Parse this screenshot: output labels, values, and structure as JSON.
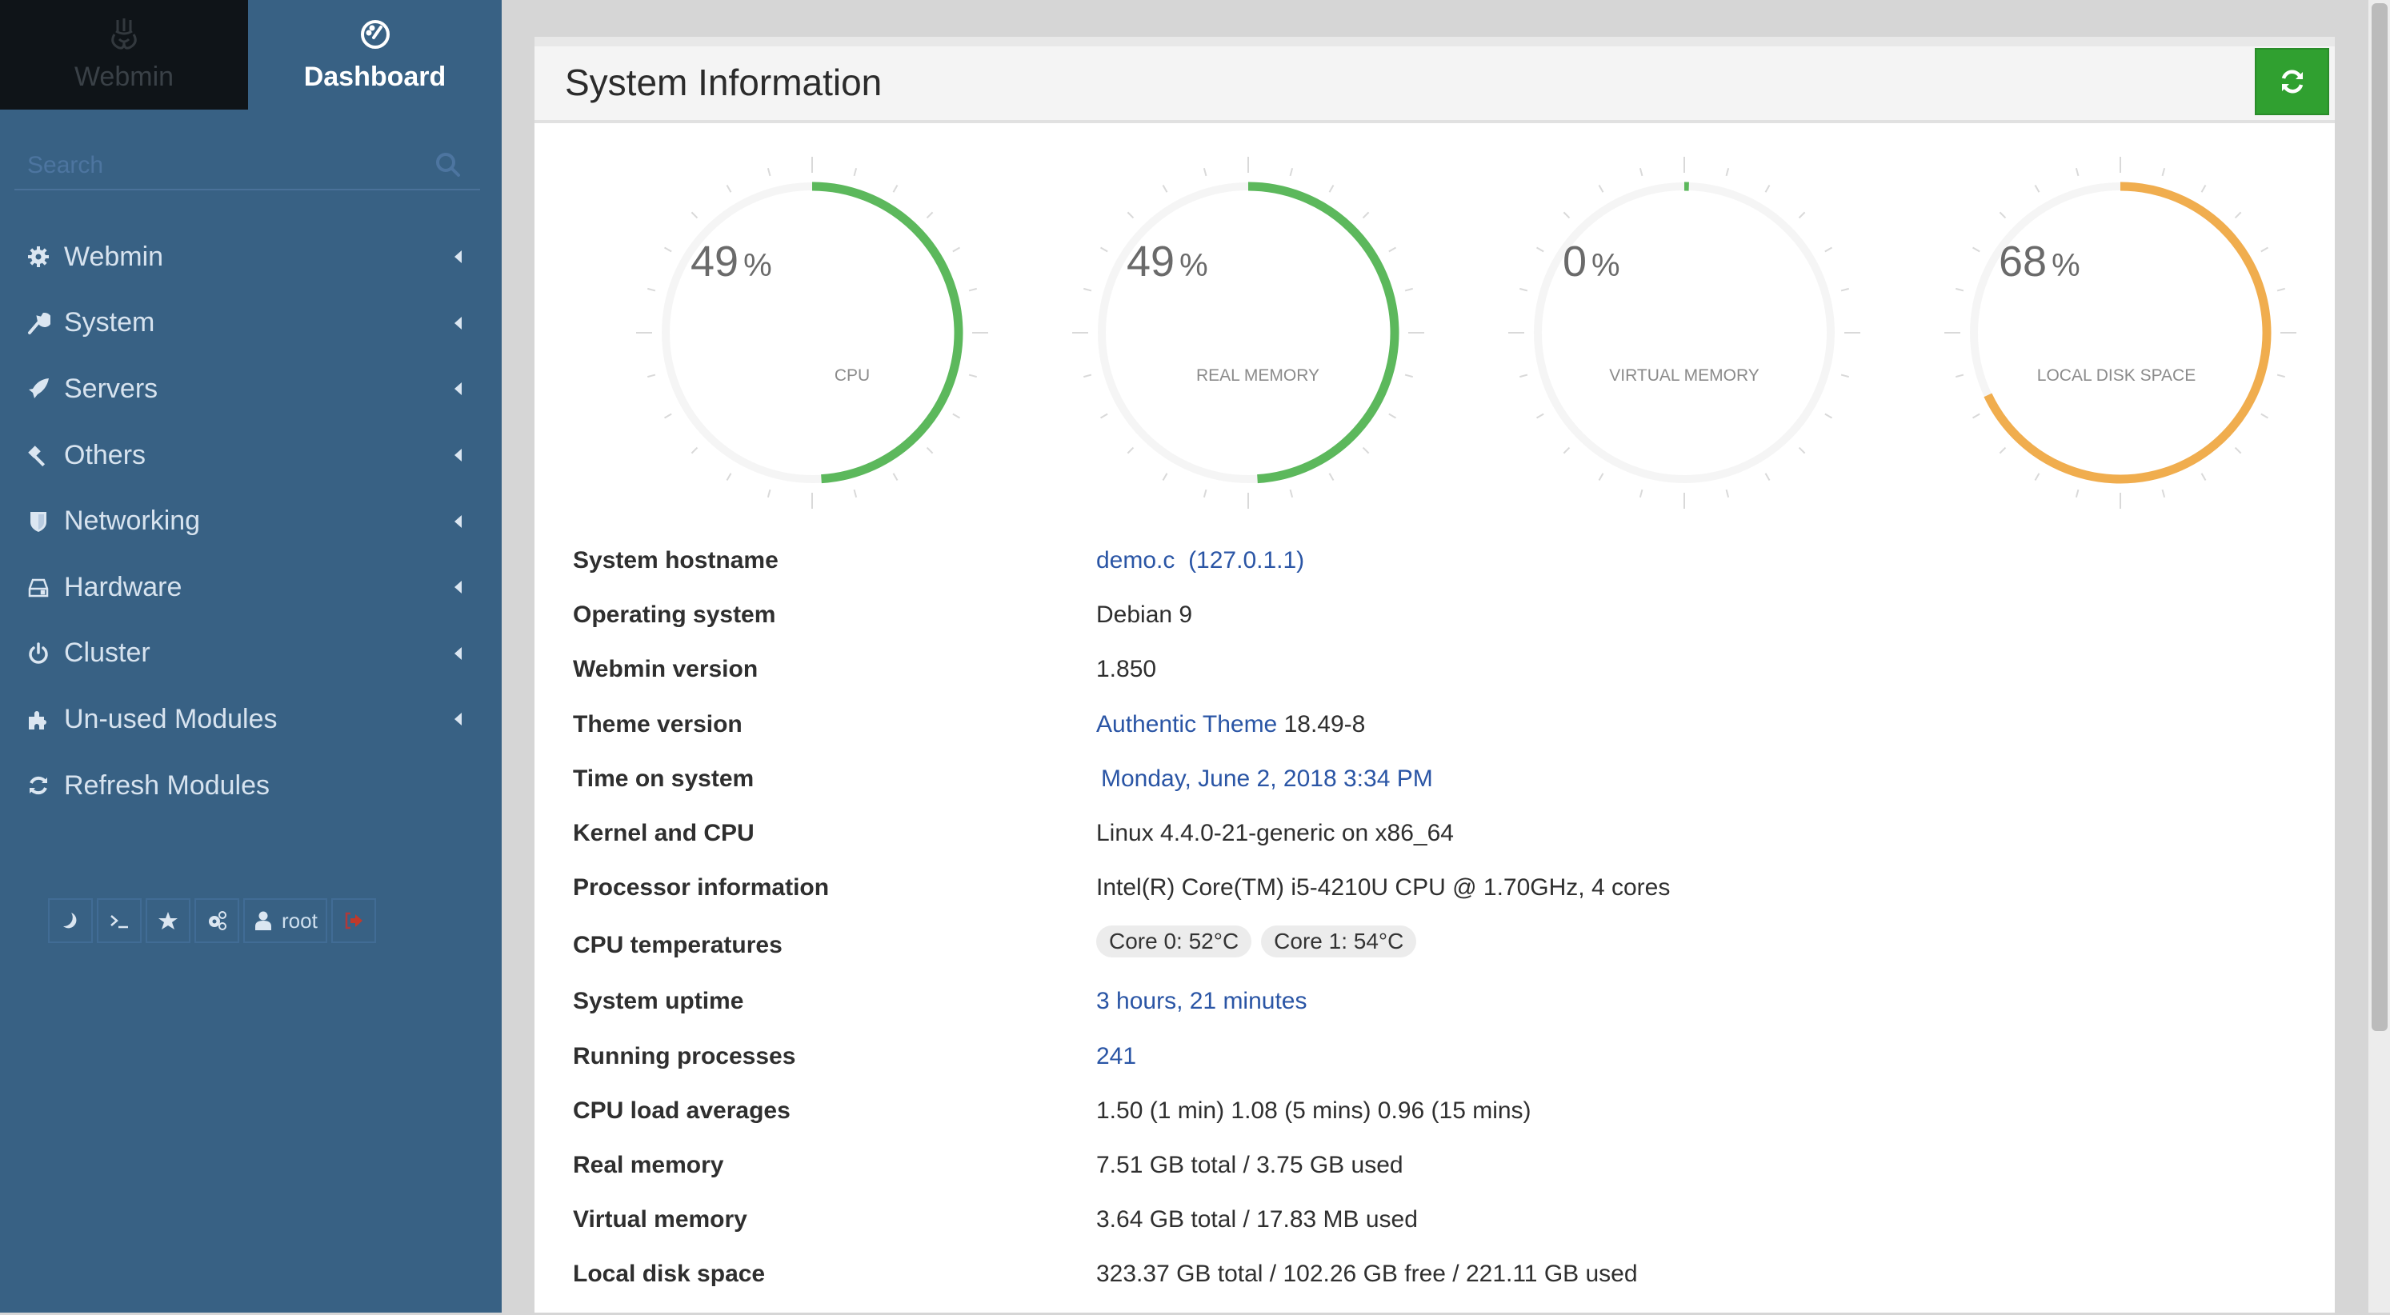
{
  "sidebar": {
    "tabs": [
      {
        "label": "Webmin",
        "icon": "webmin-logo-icon",
        "active": false
      },
      {
        "label": "Dashboard",
        "icon": "dashboard-gauge-icon",
        "active": true
      }
    ],
    "search": {
      "placeholder": "Search",
      "value": ""
    },
    "nav_items": [
      {
        "label": "Webmin",
        "icon": "gear-icon",
        "has_submenu": true
      },
      {
        "label": "System",
        "icon": "wrench-icon",
        "has_submenu": true
      },
      {
        "label": "Servers",
        "icon": "rocket-icon",
        "has_submenu": true
      },
      {
        "label": "Others",
        "icon": "gavel-icon",
        "has_submenu": true
      },
      {
        "label": "Networking",
        "icon": "shield-icon",
        "has_submenu": true
      },
      {
        "label": "Hardware",
        "icon": "hdd-icon",
        "has_submenu": true
      },
      {
        "label": "Cluster",
        "icon": "power-icon",
        "has_submenu": true
      },
      {
        "label": "Un-used Modules",
        "icon": "puzzle-icon",
        "has_submenu": true
      },
      {
        "label": "Refresh Modules",
        "icon": "refresh-icon",
        "has_submenu": false
      }
    ],
    "toolbar": {
      "night_mode_icon": "moon-icon",
      "terminal_icon": "terminal-icon",
      "favorites_icon": "star-icon",
      "settings_icon": "cogs-icon",
      "user_icon": "user-icon",
      "user_label": "root",
      "logout_icon": "sign-out-icon"
    }
  },
  "panel": {
    "title": "System Information",
    "refresh_icon": "refresh-icon",
    "refresh_color": "#30a030"
  },
  "gauges": [
    {
      "value": 49,
      "unit": "%",
      "label": "CPU",
      "color": "#5cb85c"
    },
    {
      "value": 49,
      "unit": "%",
      "label": "REAL MEMORY",
      "color": "#5cb85c"
    },
    {
      "value": 0,
      "unit": "%",
      "label": "VIRTUAL MEMORY",
      "color": "#5cb85c"
    },
    {
      "value": 68,
      "unit": "%",
      "label": "LOCAL DISK SPACE",
      "color": "#f0ad4e"
    }
  ],
  "info": {
    "hostname": {
      "label": "System hostname",
      "value": "demo.c",
      "extra": "(127.0.1.1)"
    },
    "os": {
      "label": "Operating system",
      "value": "Debian 9"
    },
    "webmin_version": {
      "label": "Webmin version",
      "value": "1.850"
    },
    "theme_version": {
      "label": "Theme version",
      "link": "Authentic Theme",
      "value": "18.49-8"
    },
    "time": {
      "label": "Time on system",
      "value": "Monday, June 2, 2018 3:34 PM"
    },
    "kernel": {
      "label": "Kernel and CPU",
      "value": "Linux 4.4.0-21-generic on x86_64"
    },
    "processor": {
      "label": "Processor information",
      "value": "Intel(R) Core(TM) i5-4210U CPU @ 1.70GHz, 4 cores"
    },
    "temps": {
      "label": "CPU temperatures",
      "badges": [
        "Core 0: 52°C",
        "Core 1: 54°C"
      ]
    },
    "uptime": {
      "label": "System uptime",
      "value": "3 hours, 21 minutes"
    },
    "processes": {
      "label": "Running processes",
      "value": "241"
    },
    "load": {
      "label": "CPU load averages",
      "value": "1.50 (1 min) 1.08 (5 mins) 0.96 (15 mins)"
    },
    "real_memory": {
      "label": "Real memory",
      "value": "7.51 GB total / 3.75 GB used"
    },
    "virtual_memory": {
      "label": "Virtual memory",
      "value": "3.64 GB total / 17.83 MB used"
    },
    "disk": {
      "label": "Local disk space",
      "value": "323.37 GB total / 102.26 GB free / 221.11 GB used"
    }
  },
  "colors": {
    "sidebar_bg": "#386184",
    "link": "#2a55a5",
    "gauge_ok": "#5cb85c",
    "gauge_warn": "#f0ad4e"
  }
}
